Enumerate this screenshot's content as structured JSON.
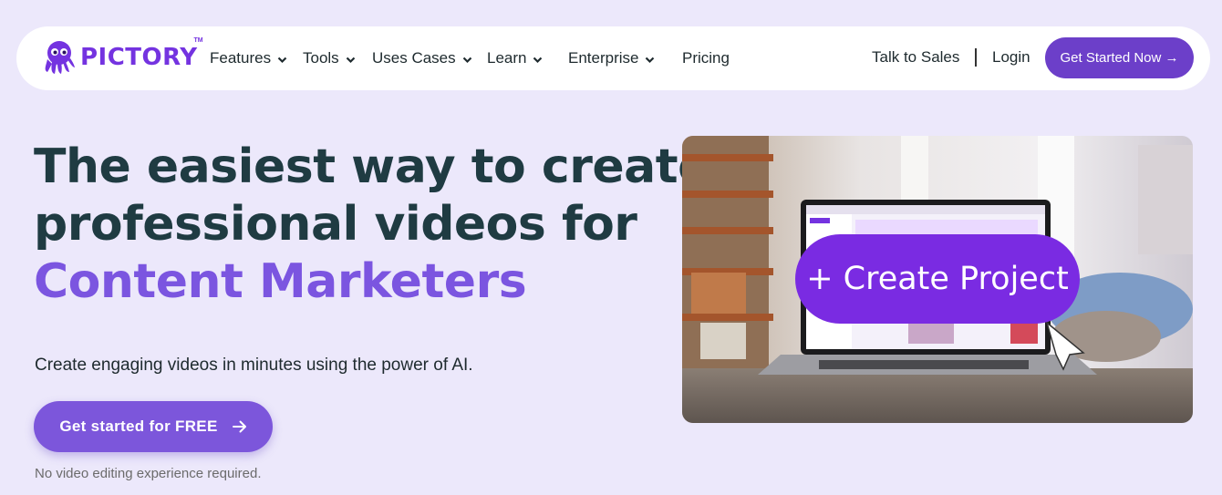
{
  "brand": {
    "name": "PICTORY",
    "trademark": "TM",
    "accent": "#7433e0"
  },
  "nav": {
    "items": [
      {
        "label": "Features",
        "dropdown": true
      },
      {
        "label": "Tools",
        "dropdown": true
      },
      {
        "label": "Uses Cases",
        "dropdown": true
      },
      {
        "label": "Learn",
        "dropdown": true
      },
      {
        "label": "Enterprise",
        "dropdown": true
      },
      {
        "label": "Pricing",
        "dropdown": false
      }
    ],
    "talk_to_sales": "Talk to Sales",
    "login": "Login",
    "cta": "Get Started Now →"
  },
  "hero": {
    "headline_line1": "The easiest way to create",
    "headline_line2": "professional videos for",
    "headline_accent": "Content Marketers",
    "subtext": "Create engaging videos in minutes using the power of AI.",
    "cta": "Get started for FREE",
    "note": "No video editing experience required.",
    "image_overlay": "+ Create Project"
  },
  "colors": {
    "background": "#ece8fb",
    "headline": "#1f3b42",
    "accent_text": "#7b55e0",
    "button": "#7c56db",
    "nav_button": "#6c3fc9"
  }
}
